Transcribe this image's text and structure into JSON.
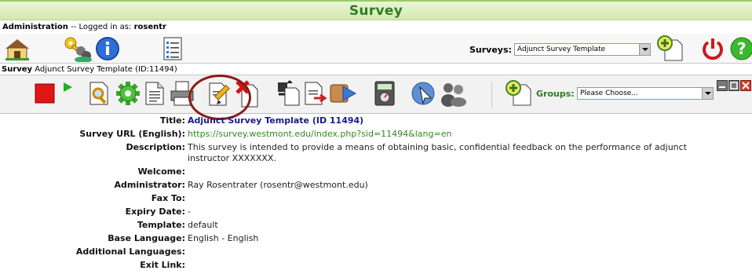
{
  "app": {
    "title": "Survey"
  },
  "admin": {
    "prefix": "Administration",
    "separator": " -- Logged in as: ",
    "user": "rosentr"
  },
  "admin_toolbar": {
    "icons": [
      "home-icon",
      "security-keys-icon",
      "information-icon",
      "list-document-icon",
      "add-survey-icon",
      "logout-icon",
      "help-icon"
    ],
    "surveys_label": "Surveys:",
    "surveys_selected": "Adjunct Survey Template"
  },
  "survey_header": {
    "prefix": "Survey",
    "name": "Adjunct Survey Template (ID:11494)"
  },
  "survey_toolbar": {
    "icons": [
      "stop-icon",
      "play-icon",
      "test-survey-icon",
      "settings-gear-icon",
      "document-icon",
      "print-icon",
      "edit-survey-icon",
      "delete-survey-icon",
      "export-icon",
      "import-icon",
      "tokens-icon",
      "results-icon",
      "calculator-icon",
      "quota-icon",
      "participants-icon",
      "add-group-icon",
      "minimize-icon",
      "maximize-icon",
      "close-icon"
    ],
    "groups_label": "Groups:",
    "groups_selected": "Please Choose..."
  },
  "details": [
    {
      "label": "Title:",
      "value": "Adjunct Survey Template (ID 11494)"
    },
    {
      "label": "Survey URL (English):",
      "value": "https://survey.westmont.edu/index.php?sid=11494&lang=en"
    },
    {
      "label": "Description:",
      "value": "This survey is intended to provide a means of obtaining basic, confidential feedback on the performance of adjunct instructor XXXXXXX."
    },
    {
      "label": "Welcome:",
      "value": ""
    },
    {
      "label": "Administrator:",
      "value": "Ray Rosentrater (rosentr@westmont.edu)"
    },
    {
      "label": "Fax To:",
      "value": ""
    },
    {
      "label": "Expiry Date:",
      "value": "-"
    },
    {
      "label": "Template:",
      "value": "default"
    },
    {
      "label": "Base Language:",
      "value": "English - English"
    },
    {
      "label": "Additional Languages:",
      "value": ""
    },
    {
      "label": "Exit Link:",
      "value": ""
    }
  ],
  "colors": {
    "title_green": "#2f7d1f",
    "title_blue": "#1a1a8c",
    "url_green": "#2f8a1f",
    "annotation_circle": "#8b1a1a"
  }
}
